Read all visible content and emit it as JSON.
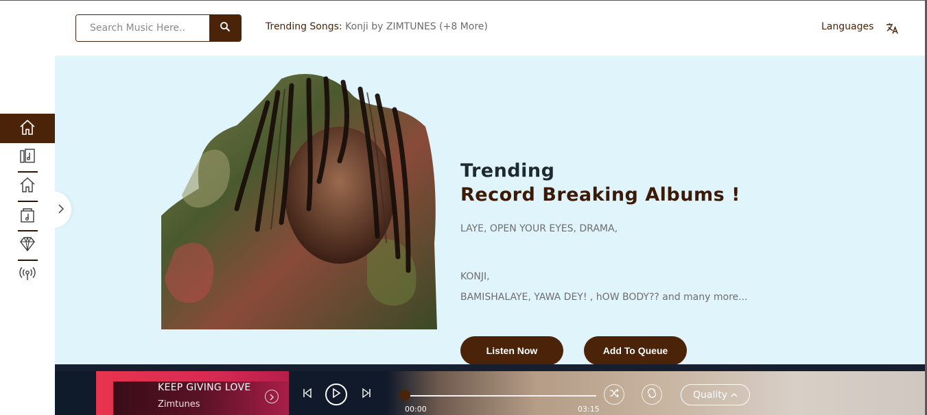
{
  "search": {
    "placeholder": "Search Music Here.."
  },
  "header": {
    "trending_label": "Trending Songs:",
    "trending_value": "Konji by ZIMTUNES (+8 More)",
    "languages_label": "Languages"
  },
  "sidebar": {
    "items": [
      {
        "name": "home",
        "icon": "home-icon",
        "active": true
      },
      {
        "name": "music-library",
        "icon": "music-library-icon",
        "active": false
      },
      {
        "name": "home-alt",
        "icon": "home-icon",
        "active": false
      },
      {
        "name": "music-file",
        "icon": "music-file-icon",
        "active": false
      },
      {
        "name": "premium",
        "icon": "diamond-icon",
        "active": false
      },
      {
        "name": "podcast",
        "icon": "broadcast-icon",
        "active": false
      }
    ]
  },
  "hero": {
    "title_line1": "Trending",
    "title_line2": "Record Breaking Albums !",
    "lines": [
      "LAYE, OPEN YOUR EYES, DRAMA,",
      "KONJI,",
      "BAMISHALAYE, YAWA DEY! , hOW BODY?? and many more..."
    ],
    "listen_label": "Listen Now",
    "queue_label": "Add To Queue"
  },
  "player": {
    "song_title": "KEEP GIVING LOVE",
    "song_artist": "Zimtunes",
    "current_time": "00:00",
    "total_time": "03:15",
    "progress": 0,
    "quality_label": "Quality"
  },
  "colors": {
    "brand_brown": "#4a2308",
    "hero_bg": "#e0f4fb",
    "now_playing_red": "#e8344e"
  }
}
